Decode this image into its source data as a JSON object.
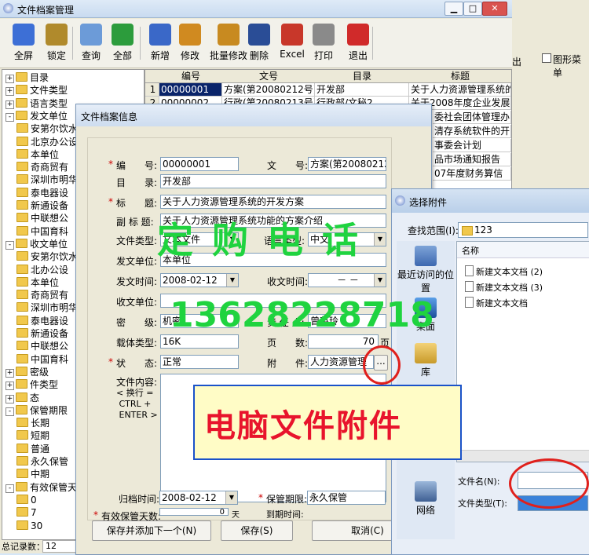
{
  "app": {
    "title": "文件档案管理",
    "right_tool_label": "出",
    "right_checkbox_label": "图形菜单"
  },
  "toolbar": [
    {
      "label": "全屏",
      "icon": "gear-icon",
      "color": "#3d6fd6"
    },
    {
      "label": "锁定",
      "icon": "key-icon",
      "color": "#b08a2c"
    },
    {
      "label": "查询",
      "icon": "magnifier-icon",
      "color": "#6c9bd8"
    },
    {
      "label": "全部",
      "icon": "recycle-icon",
      "color": "#2c9c3c"
    },
    {
      "label": "新增",
      "icon": "cursor-add-icon",
      "color": "#3a68c8"
    },
    {
      "label": "修改",
      "icon": "edit-icon",
      "color": "#d08a20"
    },
    {
      "label": "批量修改",
      "icon": "chart-icon",
      "color": "#c88a20"
    },
    {
      "label": "删除",
      "icon": "bottle-delete-icon",
      "color": "#2a4d96"
    },
    {
      "label": "Excel",
      "icon": "excel-icon",
      "color": "#c8372a"
    },
    {
      "label": "打印",
      "icon": "printer-icon",
      "color": "#8a8a8a"
    },
    {
      "label": "退出",
      "icon": "exit-door-icon",
      "color": "#d02a2a"
    }
  ],
  "tree": [
    {
      "label": "目录",
      "level": 0,
      "pm": "+"
    },
    {
      "label": "文件类型",
      "level": 0,
      "pm": "+"
    },
    {
      "label": "语言类型",
      "level": 0,
      "pm": "+"
    },
    {
      "label": "发文单位",
      "level": 0,
      "pm": "-"
    },
    {
      "label": "安第尔饮水",
      "level": 1
    },
    {
      "label": "北京办公设",
      "level": 1
    },
    {
      "label": "本单位",
      "level": 1
    },
    {
      "label": "奇商贸有",
      "level": 1
    },
    {
      "label": "深圳市明华",
      "level": 1
    },
    {
      "label": "泰电器设",
      "level": 1
    },
    {
      "label": "新通设备",
      "level": 1
    },
    {
      "label": "中联想公",
      "level": 1
    },
    {
      "label": "中国育科",
      "level": 1
    },
    {
      "label": "收文单位",
      "level": 0,
      "pm": "-"
    },
    {
      "label": "安第尔饮水",
      "level": 1
    },
    {
      "label": "北办公设",
      "level": 1
    },
    {
      "label": "本单位",
      "level": 1
    },
    {
      "label": "奇商贸有",
      "level": 1
    },
    {
      "label": "深圳市明华",
      "level": 1
    },
    {
      "label": "泰电器设",
      "level": 1
    },
    {
      "label": "新通设备",
      "level": 1
    },
    {
      "label": "中联想公",
      "level": 1
    },
    {
      "label": "中国育科",
      "level": 1
    },
    {
      "label": "密级",
      "level": 0,
      "pm": "+"
    },
    {
      "label": "件类型",
      "level": 0,
      "pm": "+"
    },
    {
      "label": "态",
      "level": 0,
      "pm": "+"
    },
    {
      "label": "保管期限",
      "level": 0,
      "pm": "-"
    },
    {
      "label": "长期",
      "level": 1
    },
    {
      "label": "短期",
      "level": 1
    },
    {
      "label": "普通",
      "level": 1
    },
    {
      "label": "永久保管",
      "level": 1
    },
    {
      "label": "中期",
      "level": 1
    },
    {
      "label": "有效保管天数",
      "level": 0,
      "pm": "-"
    },
    {
      "label": "0",
      "level": 1
    },
    {
      "label": "7",
      "level": 1
    },
    {
      "label": "30",
      "level": 1
    }
  ],
  "status": {
    "label": "总记录数：",
    "value": "12"
  },
  "grid": {
    "columns": [
      "编号",
      "文号",
      "目录",
      "标题"
    ],
    "rows": [
      {
        "n": "1",
        "id": "00000001",
        "doc_no": "方案(第20080212号)",
        "dir": "开发部",
        "title": "关于人力资源管理系统的"
      },
      {
        "n": "2",
        "id": "00000002",
        "doc_no": "行政(第20080213号)",
        "dir": "行政部/文秘2",
        "title": "关于2008年度企业发展规"
      }
    ],
    "peek_cells": [
      "委社会团体管理办",
      "清存系统软件的开",
      "事委会计划",
      "品市场通知报告",
      "07年度财务算信"
    ]
  },
  "dialog": {
    "title": "文件档案信息",
    "labels": {
      "id": "编　　号:",
      "doc_no": "文　　号:",
      "dir": "目　　录:",
      "title": "标　　题:",
      "subtitle": "副 标 题:",
      "file_type": "文件类型:",
      "lang_type": "语言类型:",
      "sender": "发文单位:",
      "send_time": "发文时间:",
      "recv_time": "收文时间:",
      "receiver": "收文单位:",
      "secret": "密　　级:",
      "owner": "责 任 人:",
      "carrier": "载体类型:",
      "pages": "页　　数:",
      "state": "状　　态:",
      "attach": "附　　件:",
      "content": "文件内容:",
      "content_hint": "< 换行 =\n CTRL +\n ENTER >",
      "archive_time": "归档时间:",
      "keep_period": "保管期限:",
      "valid_days": "有效保管天数:",
      "expire_time": "到期时间:"
    },
    "values": {
      "id": "00000001",
      "doc_no": "方案(第20080212号)",
      "dir": "开发部",
      "title": "关于人力资源管理系统的开发方案",
      "subtitle": "关于人力资源管理系统功能的方案介绍",
      "file_type": "文本文件",
      "lang_type": "中文",
      "sender": "本单位",
      "send_time": "2008-02-12",
      "recv_time": "－ －",
      "receiver": "",
      "secret": "机密",
      "owner": "曾英玲",
      "carrier": "16K",
      "pages": "70",
      "pages_unit": "页",
      "state": "正常",
      "attach": "人力资源管理",
      "archive_time": "2008-02-12",
      "keep_period": "永久保管",
      "valid_days": "0",
      "valid_days_unit": "天"
    },
    "buttons": {
      "save_next": "保存并添加下一个(N)",
      "save": "保存(S)",
      "cancel": "取消(C)",
      "browse": "..."
    }
  },
  "file_dialog": {
    "title": "选择附件",
    "look_in_label": "查找范围(I):",
    "look_in_value": "123",
    "places": [
      "最近访问的位置",
      "桌面",
      "库",
      "网络"
    ],
    "column": "名称",
    "files": [
      "新建文本文档 (2)",
      "新建文本文档 (3)",
      "新建文本文档"
    ],
    "filename_label": "文件名(N):",
    "filetype_label": "文件类型(T):",
    "filename_value": ""
  },
  "overlay": {
    "order_text": "定 购 电 话",
    "phone": "13628228718",
    "banner": "电脑文件附件"
  }
}
